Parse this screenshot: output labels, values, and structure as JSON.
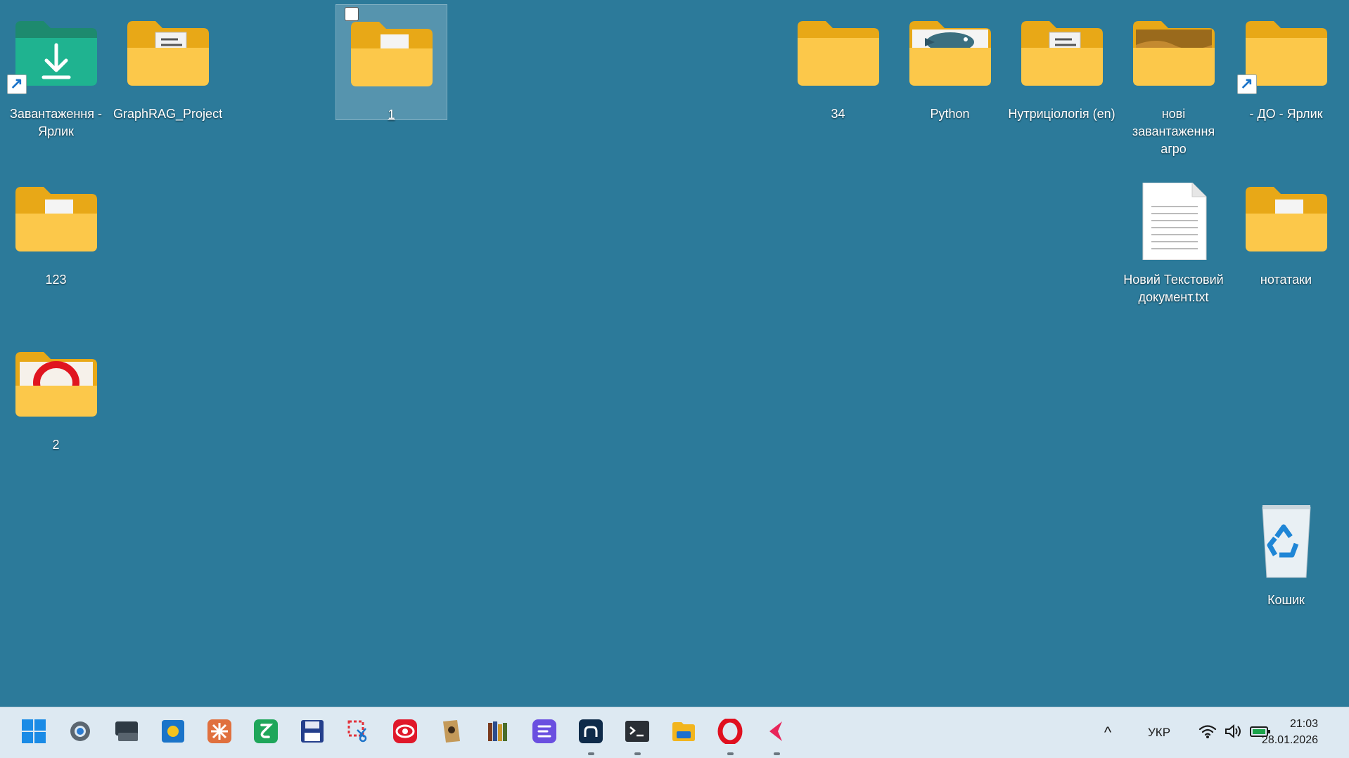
{
  "desktop": {
    "icons": [
      {
        "label": "Завантаження - Ярлик",
        "kind": "download-shortcut-icon"
      },
      {
        "label": "GraphRAG_Project",
        "kind": "folder-icon"
      },
      {
        "label": "1",
        "kind": "folder-icon",
        "selected": true
      },
      {
        "label": "34",
        "kind": "folder-icon"
      },
      {
        "label": "Python",
        "kind": "folder-icon"
      },
      {
        "label": "Нутриціологія (en)",
        "kind": "folder-icon"
      },
      {
        "label": "нові завантаження агро",
        "kind": "folder-icon"
      },
      {
        "label": "- ДО - Ярлик",
        "kind": "folder-shortcut-icon"
      },
      {
        "label": "123",
        "kind": "folder-icon"
      },
      {
        "label": "Новий Текстовий документ.txt",
        "kind": "text-file-icon"
      },
      {
        "label": "нотатаки",
        "kind": "folder-icon"
      },
      {
        "label": "2",
        "kind": "folder-icon"
      },
      {
        "label": "Кошик",
        "kind": "recycle-bin-icon"
      }
    ]
  },
  "taskbar": {
    "apps": [
      {
        "name": "start-button",
        "icon": "windows-logo-icon"
      },
      {
        "name": "settings",
        "icon": "gear-icon"
      },
      {
        "name": "keyboard-app",
        "icon": "keyboard-icon"
      },
      {
        "name": "windows-explorer-app",
        "icon": "windows-tile-icon"
      },
      {
        "name": "claude-app",
        "icon": "sparkle-icon"
      },
      {
        "name": "green-app",
        "icon": "zeta-icon"
      },
      {
        "name": "disk-app",
        "icon": "floppy-icon"
      },
      {
        "name": "snipping-tool",
        "icon": "scissors-icon"
      },
      {
        "name": "media-app",
        "icon": "red-eye-icon"
      },
      {
        "name": "notes-app",
        "icon": "book-icon"
      },
      {
        "name": "library-app",
        "icon": "books-icon"
      },
      {
        "name": "text-app",
        "icon": "lines-icon"
      },
      {
        "name": "terminal-app-2",
        "icon": "prompt-icon"
      },
      {
        "name": "terminal",
        "icon": "terminal-icon"
      },
      {
        "name": "file-explorer",
        "icon": "folder-icon"
      },
      {
        "name": "opera",
        "icon": "opera-icon"
      },
      {
        "name": "arrow-app",
        "icon": "arrow-icon"
      }
    ],
    "tray": {
      "chevron": "^",
      "language": "УКР",
      "time": "21:03",
      "date": "28.01.2026"
    }
  }
}
